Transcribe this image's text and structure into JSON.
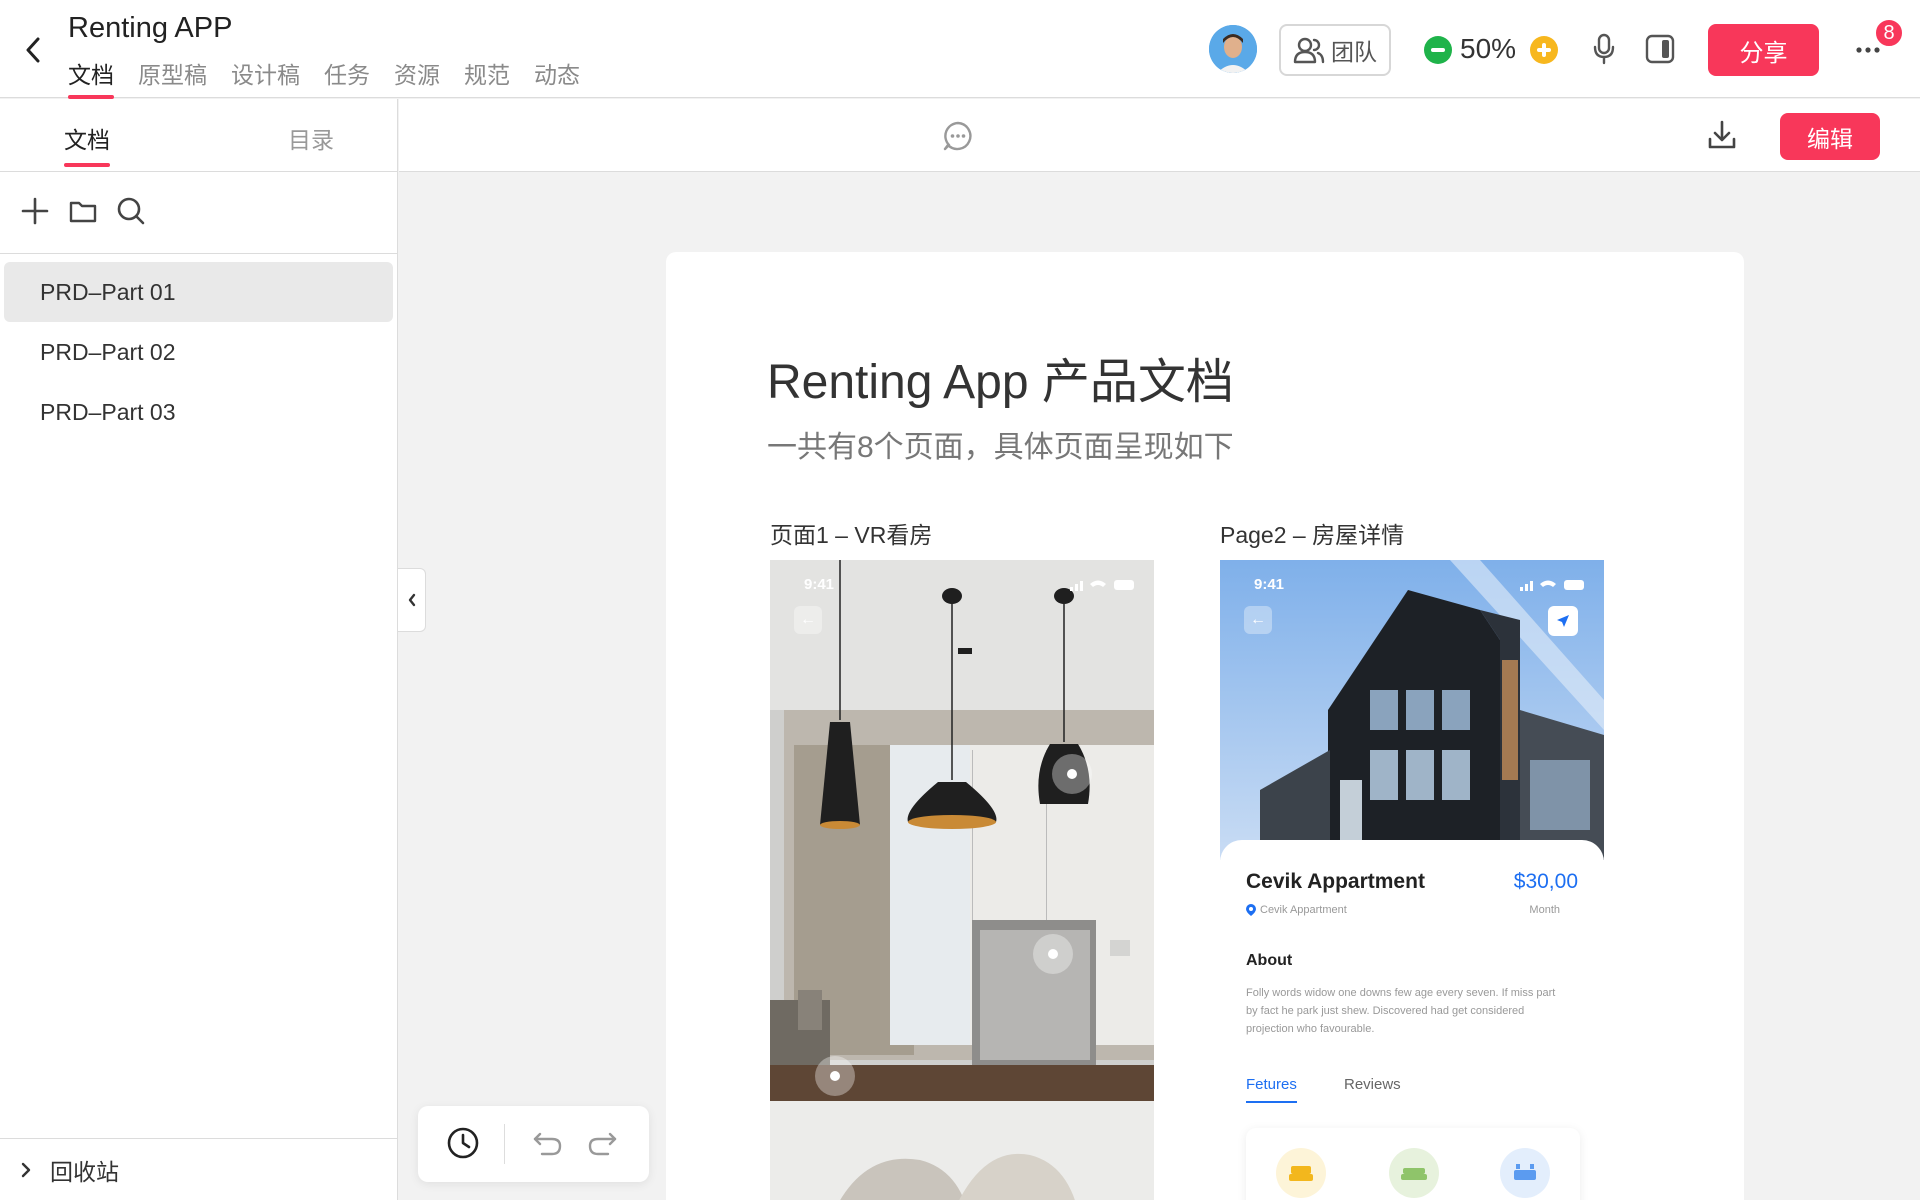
{
  "header": {
    "title": "Renting APP",
    "tabs": [
      {
        "label": "文档",
        "active": true
      },
      {
        "label": "原型稿"
      },
      {
        "label": "设计稿"
      },
      {
        "label": "任务"
      },
      {
        "label": "资源"
      },
      {
        "label": "规范"
      },
      {
        "label": "动态"
      }
    ],
    "team_label": "团队",
    "zoom": "50%",
    "share_label": "分享",
    "notifications": "8"
  },
  "sidebar": {
    "tabs": [
      {
        "label": "文档",
        "active": true
      },
      {
        "label": "目录"
      }
    ],
    "docs": [
      {
        "label": "PRD–Part 01",
        "active": true
      },
      {
        "label": "PRD–Part 02"
      },
      {
        "label": "PRD–Part 03"
      }
    ],
    "trash_label": "回收站"
  },
  "editor": {
    "edit_label": "编辑"
  },
  "document": {
    "title": "Renting App 产品文档",
    "subtitle": "一共有8个页面，具体页面呈现如下",
    "page1_label": "页面1 – VR看房",
    "page2_label": "Page2 – 房屋详情",
    "status_time": "9:41",
    "apartment": {
      "name": "Cevik Appartment",
      "price": "$30,00",
      "location": "Cevik Appartment",
      "unit": "Month",
      "about_heading": "About",
      "about_text": "Folly words widow one downs few age every seven. If miss part by fact he park just shew. Discovered had get considered projection who favourable.",
      "tab_features": "Fetures",
      "tab_reviews": "Reviews"
    }
  },
  "colors": {
    "accent": "#f8375a",
    "link_blue": "#1d6ff2",
    "zoom_minus": "#1fb34a",
    "zoom_plus": "#f7b71e"
  }
}
